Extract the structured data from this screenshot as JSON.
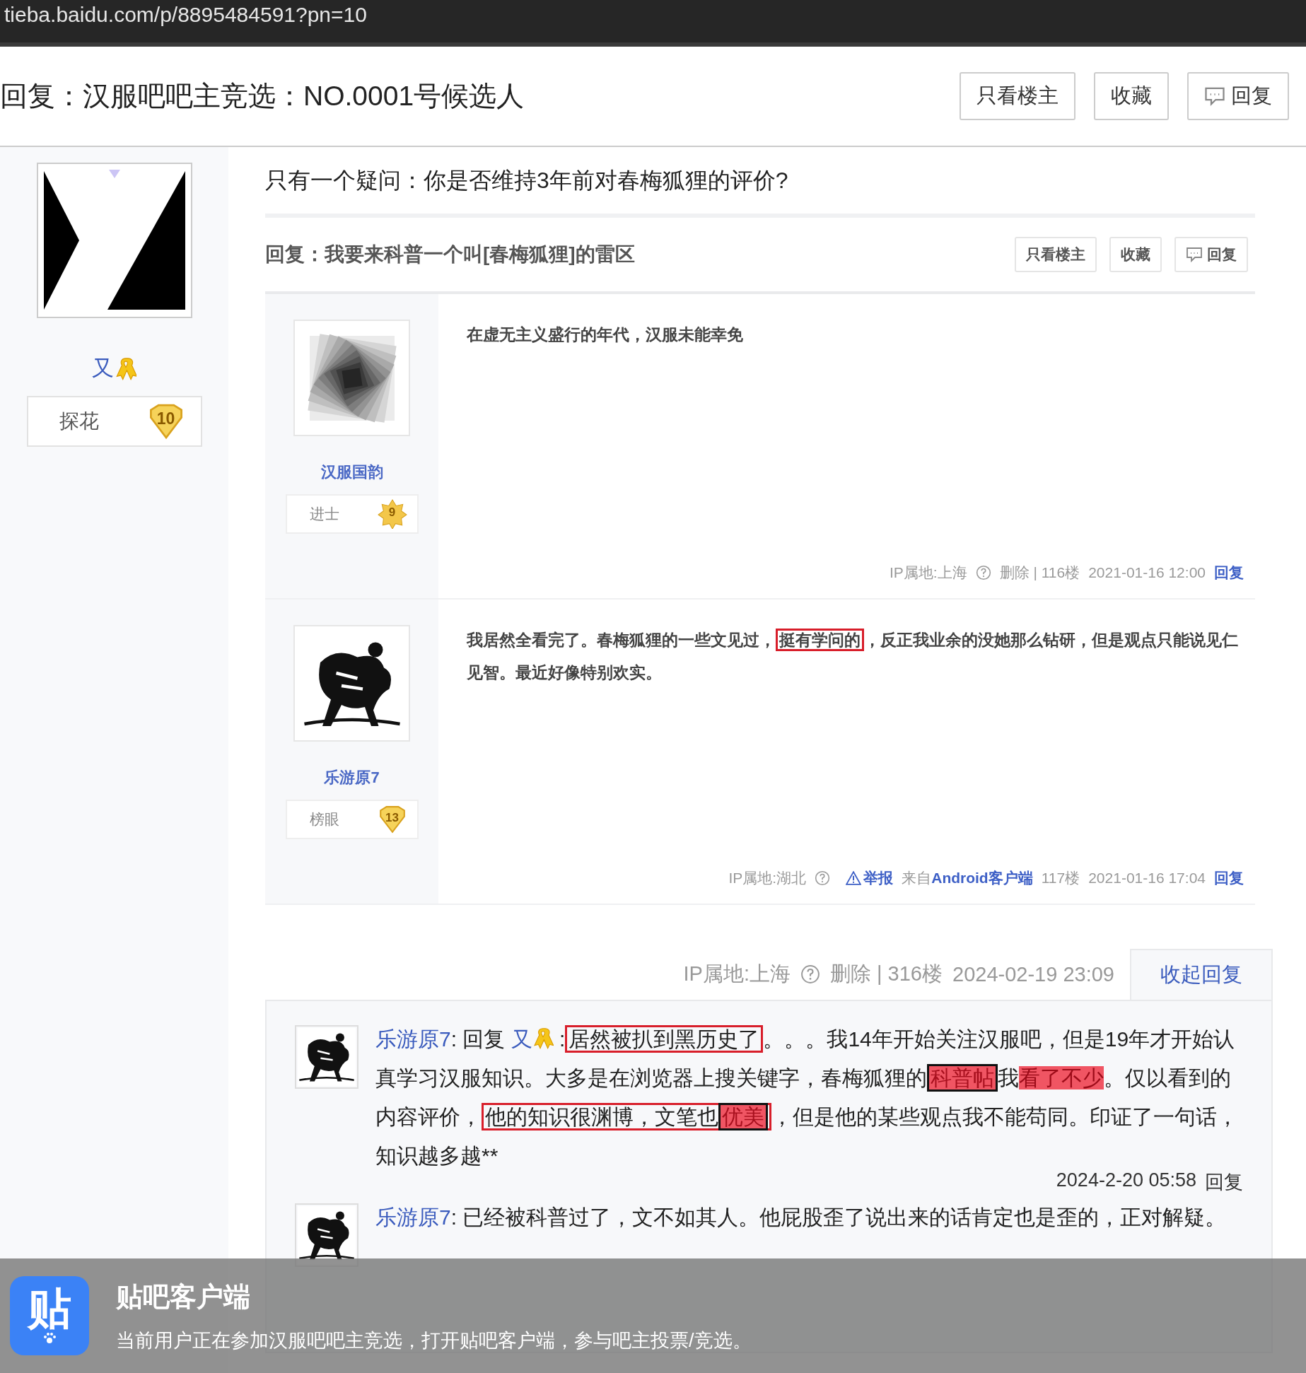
{
  "address_bar": {
    "url": "tieba.baidu.com/p/8895484591?pn=10"
  },
  "thread": {
    "title": "回复：汉服吧吧主竞选：NO.0001号候选人",
    "buttons": [
      {
        "label": "只看楼主",
        "kind": "plain"
      },
      {
        "label": "收藏",
        "kind": "plain"
      },
      {
        "label": "回复",
        "kind": "reply"
      }
    ]
  },
  "author": {
    "name": "又",
    "level_title": "探花",
    "level": "10"
  },
  "post": {
    "question": "只有一个疑问：你是否维持3年前对春梅狐狸的评价?",
    "screenshot": {
      "title": "回复：我要来科普一个叫[春梅狐狸]的雷区",
      "buttons": [
        {
          "label": "只看楼主",
          "kind": "plain"
        },
        {
          "label": "收藏",
          "kind": "plain"
        },
        {
          "label": "回复",
          "kind": "reply"
        }
      ],
      "posts": [
        {
          "name": "汉服国韵",
          "level_title": "进士",
          "level": "9",
          "badge": {
            "kind": "star"
          },
          "text": [
            {
              "kind": "plain",
              "text": "在虚无主义盛行的年代，汉服未能幸免"
            }
          ],
          "footer": [
            {
              "kind": "text",
              "text": "IP属地:上海"
            },
            {
              "kind": "help"
            },
            {
              "kind": "text",
              "text": "删除 | 116楼"
            },
            {
              "kind": "text",
              "text": "2021-01-16 12:00"
            },
            {
              "kind": "link",
              "text": "回复"
            }
          ]
        },
        {
          "name": "乐游原7",
          "level_title": "榜眼",
          "level": "13",
          "badge": {
            "kind": "shield"
          },
          "text": [
            {
              "kind": "plain",
              "text": "我居然全看完了。春梅狐狸的一些文见过，"
            },
            {
              "kind": "red-box",
              "parts": [
                {
                  "kind": "plain",
                  "text": "挺有学问的"
                }
              ]
            },
            {
              "kind": "plain",
              "text": "，反正我业余的没她那么钻研，但是观点只能说见仁见智。最近好像特别欢实。"
            }
          ],
          "footer": [
            {
              "kind": "text",
              "text": "IP属地:湖北"
            },
            {
              "kind": "help"
            },
            {
              "kind": "warn-link",
              "text": "举报"
            },
            {
              "kind": "source",
              "prefix": "来自",
              "text": "Android客户端"
            },
            {
              "kind": "text",
              "text": "117楼"
            },
            {
              "kind": "text",
              "text": "2021-01-16 17:04"
            },
            {
              "kind": "link",
              "text": "回复"
            }
          ]
        }
      ]
    },
    "footer": {
      "ip": "IP属地:上海",
      "actions": "删除 | 316楼",
      "time": "2024-02-19 23:09",
      "toggle": "收起回复"
    },
    "replies": [
      {
        "text": [
          {
            "kind": "user",
            "text": "乐游原7"
          },
          {
            "kind": "plain",
            "text": ": 回复 "
          },
          {
            "kind": "mention",
            "text": "又"
          },
          {
            "kind": "ribbon"
          },
          {
            "kind": "plain",
            "text": " :"
          },
          {
            "kind": "red-box",
            "parts": [
              {
                "kind": "plain",
                "text": "居然被扒到黑历史了"
              }
            ]
          },
          {
            "kind": "plain",
            "text": "。。。我14年开始关注汉服吧，但是19年才开始认真学习汉服知识。大多是在浏览器上搜关键字，春梅狐狸的"
          },
          {
            "kind": "black-box",
            "text": "科普帖"
          },
          {
            "kind": "plain",
            "text": "我"
          },
          {
            "kind": "red-fill",
            "text": "看了不少"
          },
          {
            "kind": "plain",
            "text": "。仅以看到的内容评价，"
          },
          {
            "kind": "red-box",
            "parts": [
              {
                "kind": "plain",
                "text": "他的知识很渊博，文笔也"
              },
              {
                "kind": "black-box",
                "text": "优美"
              }
            ]
          },
          {
            "kind": "plain",
            "text": "，但是他的某些观点我不能苟同。印证了一句话，知识越多越**"
          }
        ],
        "time": "2024-2-20 05:58",
        "action": "回复"
      },
      {
        "text": [
          {
            "kind": "user",
            "text": "乐游原7"
          },
          {
            "kind": "plain",
            "text": ": 已经被科普过了，文不如其人。他屁股歪了说出来的话肯定也是歪的，正对解疑。"
          }
        ]
      }
    ]
  },
  "app_banner": {
    "icon_text": "贴",
    "title": "贴吧客户端",
    "text": "当前用户正在参加汉服吧吧主竞选，打开贴吧客户端，参与吧主投票/竞选。"
  }
}
